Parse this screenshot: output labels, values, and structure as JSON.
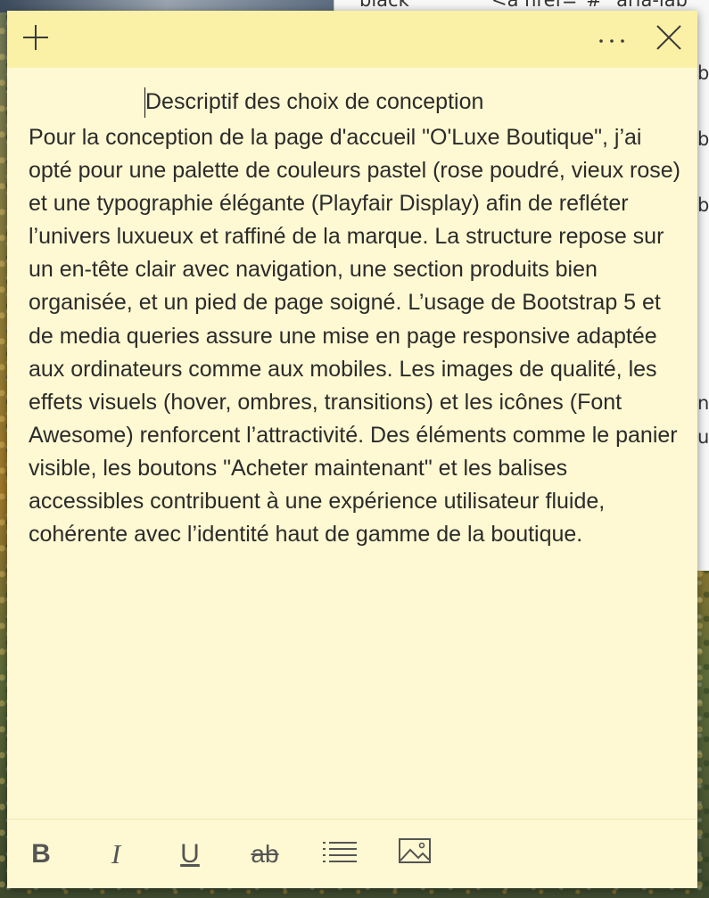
{
  "background": {
    "editor_lines": [
      {
        "text": "black"
      },
      {
        "text": "<a href=\"#\" aria-lab"
      },
      {
        "text": "b"
      },
      {
        "text": "b"
      },
      {
        "text": "b"
      },
      {
        "text": "n"
      },
      {
        "text": "u"
      }
    ]
  },
  "note": {
    "title": "Descriptif des choix de conception",
    "body": "Pour la conception de la page d'accueil \"O'Luxe Boutique\", j’ai opté pour une palette de couleurs pastel (rose poudré, vieux rose) et une typographie élégante (Playfair Display) afin de refléter l’univers luxueux et raffiné de la marque. La structure repose sur un en-tête clair avec navigation, une section produits bien organisée, et un pied de page soigné. L’usage de Bootstrap 5 et de media queries assure une mise en page responsive adaptée aux ordinateurs comme aux mobiles. Les images de qualité, les effets visuels (hover, ombres, transitions) et les icônes (Font Awesome) renforcent l’attractivité. Des éléments comme le panier visible, les boutons \"Acheter maintenant\" et les balises accessibles contribuent à une expérience utilisateur fluide, cohérente avec l’identité haut de gamme de la boutique.",
    "colors": {
      "titlebar": "#fbf1a6",
      "body": "#fef9d2"
    }
  },
  "titlebar": {
    "add_icon": "plus-icon",
    "more_icon": "more-horizontal-icon",
    "close_icon": "close-icon"
  },
  "toolbar": {
    "bold_label": "B",
    "italic_label": "I",
    "underline_label": "U",
    "strike_label": "ab",
    "list_icon": "bullet-list-icon",
    "image_icon": "image-icon"
  }
}
